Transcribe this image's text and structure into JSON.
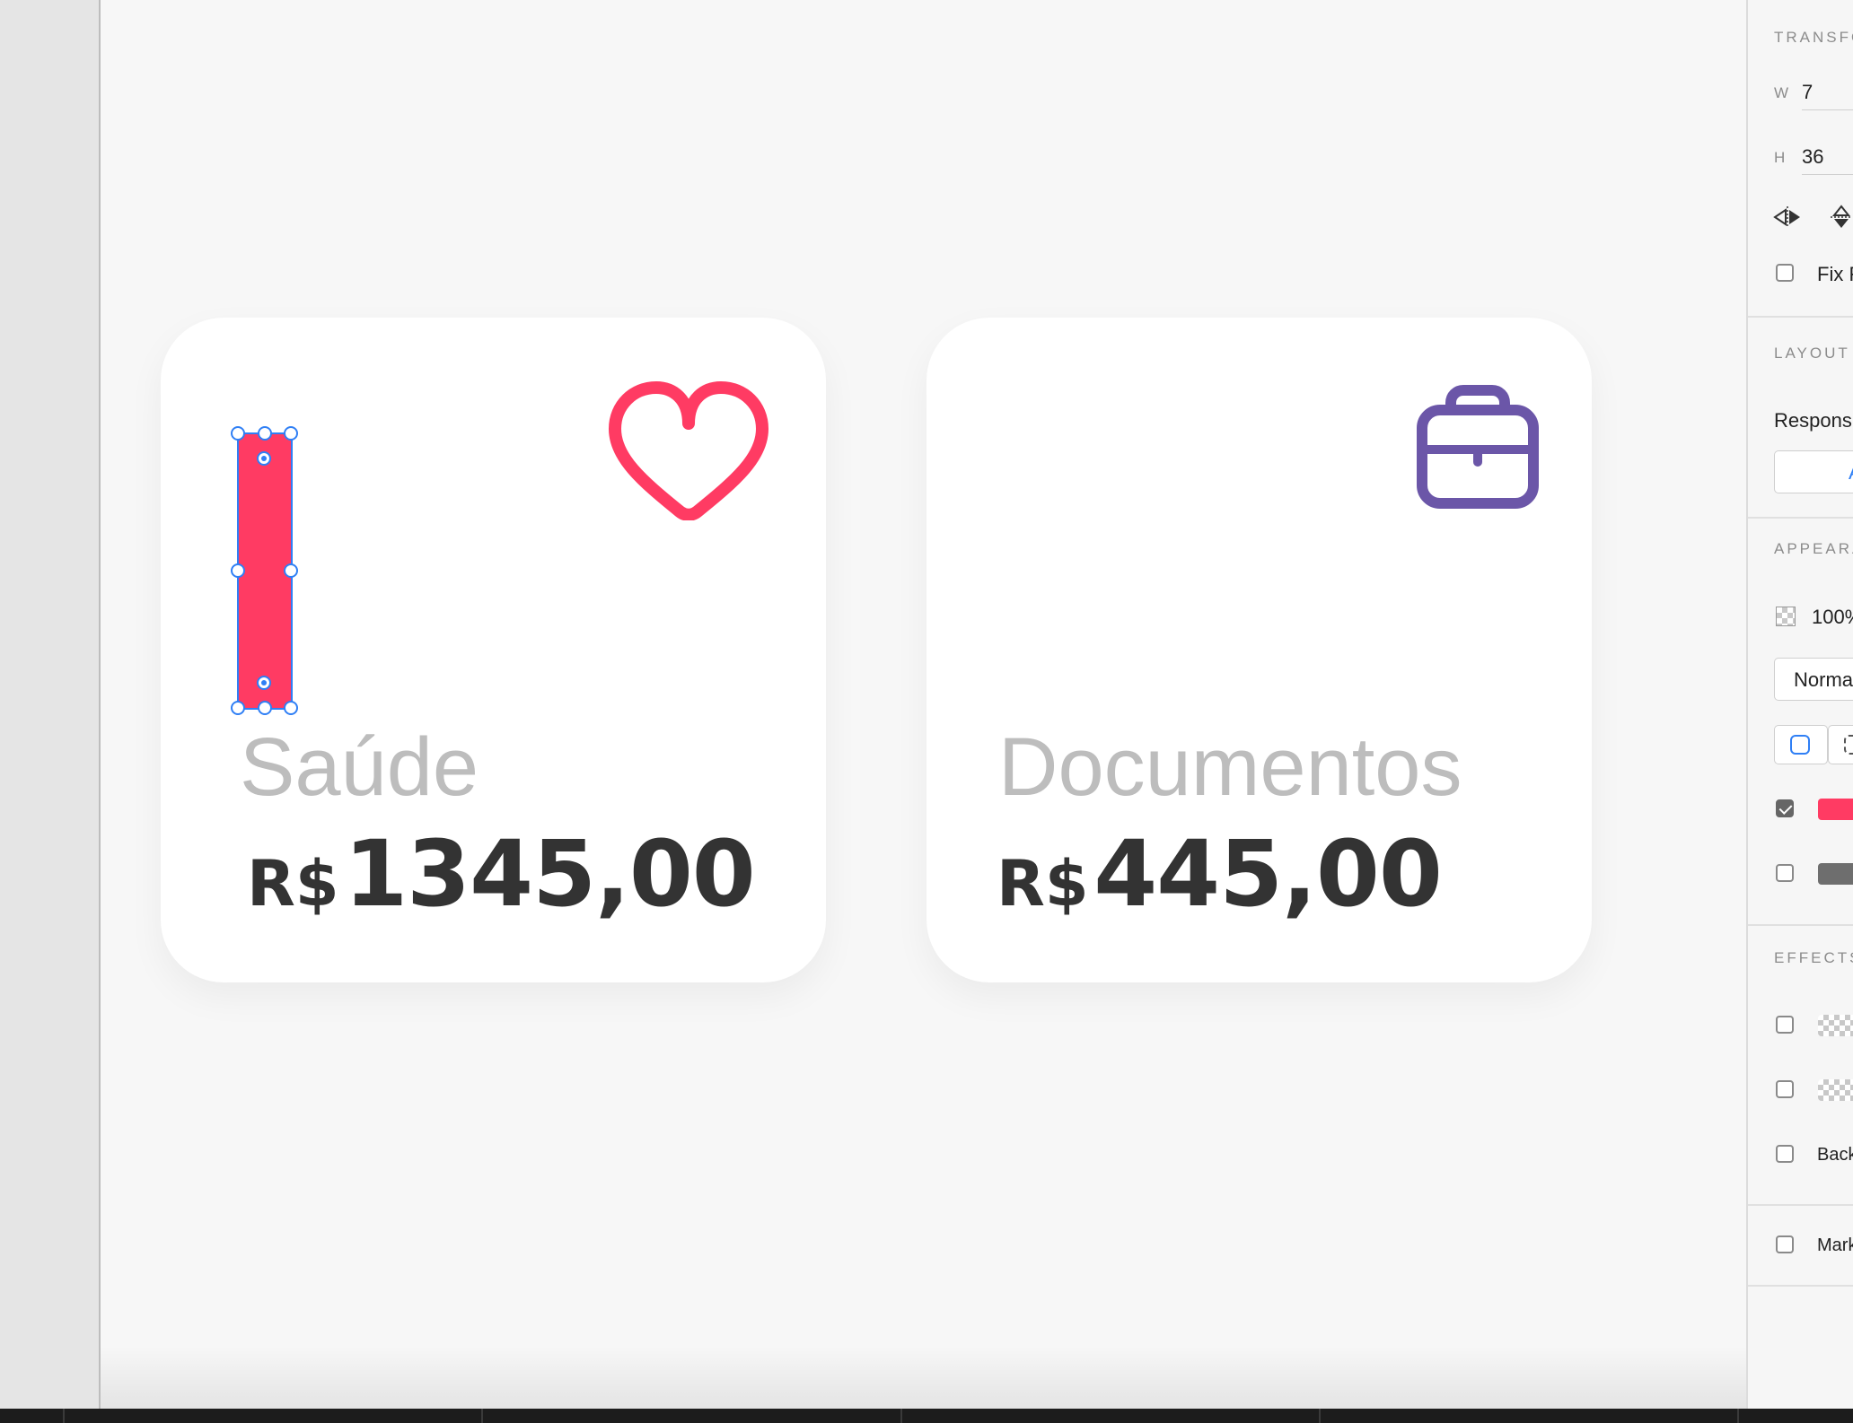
{
  "cards": [
    {
      "label": "Saúde",
      "currency": "R$",
      "amount": "1345,00",
      "icon": "heart-icon",
      "icon_color": "#ff3b63"
    },
    {
      "label": "Documentos",
      "currency": "R$",
      "amount": "445,00",
      "icon": "briefcase-icon",
      "icon_color": "#6b56a8"
    }
  ],
  "selection": {
    "fill": "#ff3b63",
    "outline": "#2f7ff5"
  },
  "inspector": {
    "transform": {
      "title": "TRANSFO",
      "w_label": "W",
      "w_value": "7",
      "h_label": "H",
      "h_value": "36",
      "fix_label": "Fix F"
    },
    "layout": {
      "title": "LAYOUT",
      "responsive_label": "Respons",
      "button_label": "A"
    },
    "appearance": {
      "title": "APPEARA",
      "opacity": "100%",
      "blend_mode": "Norma",
      "fill_color": "#ff3b63",
      "border_color": "#6e6e6e"
    },
    "effects": {
      "title": "EFFECTS",
      "background_label": "Back",
      "mark_label": "Mark"
    }
  }
}
